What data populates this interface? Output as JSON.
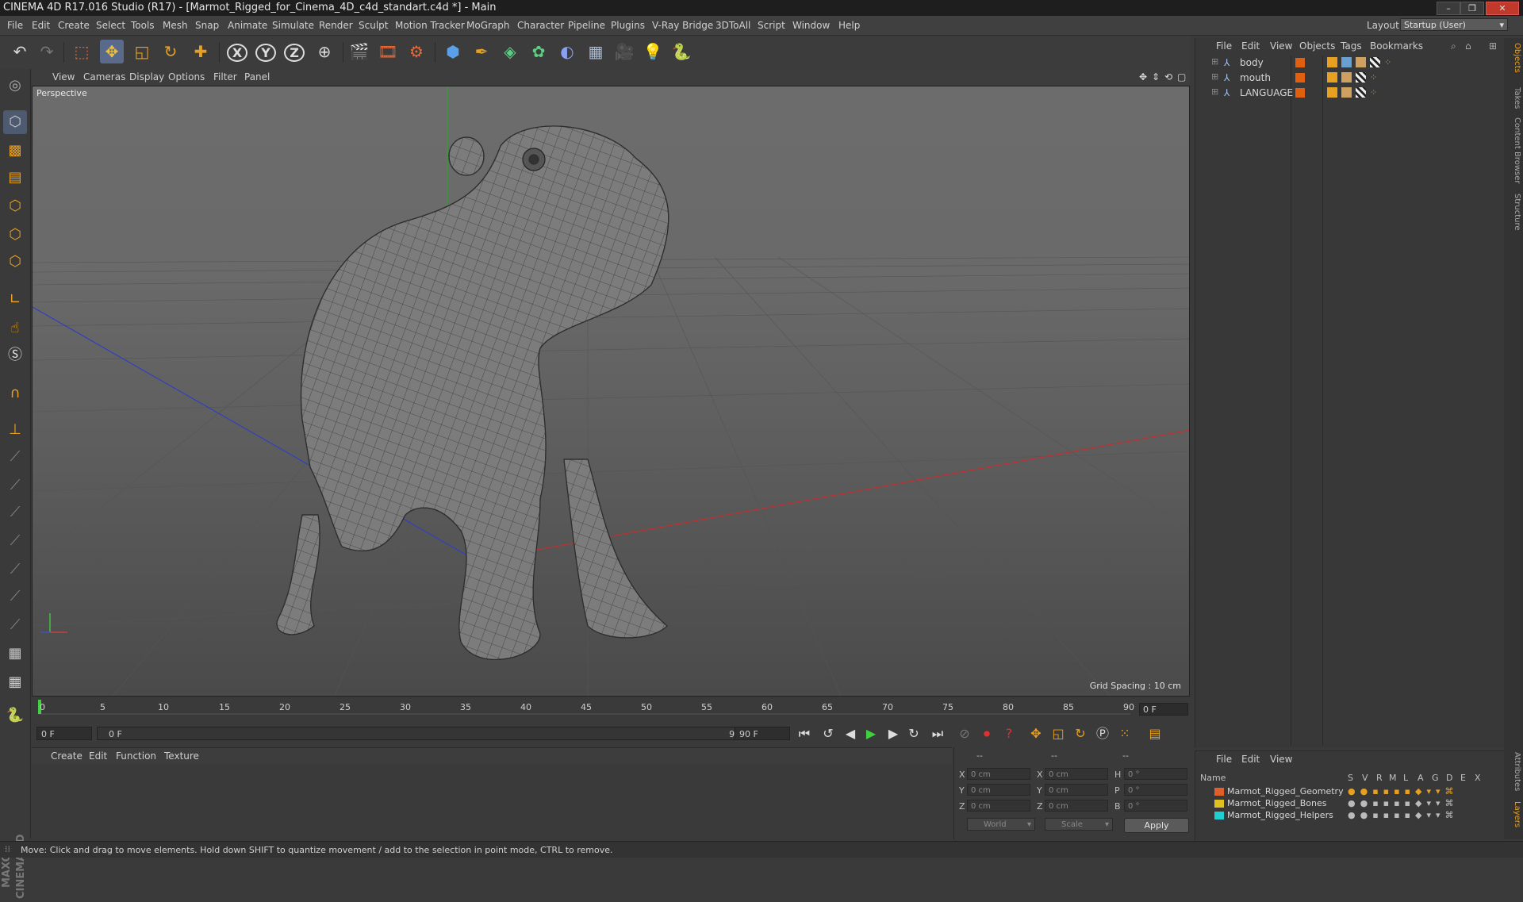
{
  "window": {
    "title": "CINEMA 4D R17.016 Studio (R17) - [Marmot_Rigged_for_Cinema_4D_c4d_standart.c4d *] - Main"
  },
  "menubar": {
    "items": [
      "File",
      "Edit",
      "Create",
      "Select",
      "Tools",
      "Mesh",
      "Snap",
      "Animate",
      "Simulate",
      "Render",
      "Sculpt",
      "Motion Tracker",
      "MoGraph",
      "Character",
      "Pipeline",
      "Plugins",
      "V-Ray Bridge",
      "3DToAll",
      "Script",
      "Window",
      "Help"
    ],
    "layout_label": "Layout:",
    "layout_value": "Startup (User)"
  },
  "toolbar": {
    "icons": [
      "undo-icon",
      "redo-icon",
      "select-icon",
      "move-icon",
      "scale-icon",
      "rotate-icon",
      "transform-icon",
      "x-axis-icon",
      "y-axis-icon",
      "z-axis-icon",
      "world-coord-icon",
      "render-view-icon",
      "render-picture-viewer-icon",
      "edit-render-settings-icon",
      "cube-icon",
      "pen-icon",
      "subdivision-icon",
      "cloner-icon",
      "deformer-icon",
      "floor-icon",
      "camera-icon",
      "light-icon",
      "python-icon"
    ],
    "axis_x": "X",
    "axis_y": "Y",
    "axis_z": "Z"
  },
  "viewport": {
    "menu": [
      "View",
      "Cameras",
      "Display",
      "Options",
      "Filter",
      "Panel"
    ],
    "label": "Perspective",
    "grid_spacing": "Grid Spacing : 10 cm"
  },
  "timeline": {
    "ticks": [
      "0",
      "5",
      "10",
      "15",
      "20",
      "25",
      "30",
      "35",
      "40",
      "45",
      "50",
      "55",
      "60",
      "65",
      "70",
      "75",
      "80",
      "85",
      "90"
    ],
    "current_frame": "0 F",
    "start_field": "0 F",
    "range_start": "0 F",
    "range_end": "90 F",
    "end_field": "90 F"
  },
  "material_manager": {
    "menu": [
      "Create",
      "Edit",
      "Function",
      "Texture"
    ]
  },
  "coordinates": {
    "headers": [
      "--",
      "--",
      "--"
    ],
    "rows": [
      {
        "label": "X",
        "pos": "0 cm",
        "size_label": "X",
        "size": "0 cm",
        "rot_label": "H",
        "rot": "0 °"
      },
      {
        "label": "Y",
        "pos": "0 cm",
        "size_label": "Y",
        "size": "0 cm",
        "rot_label": "P",
        "rot": "0 °"
      },
      {
        "label": "Z",
        "pos": "0 cm",
        "size_label": "Z",
        "size": "0 cm",
        "rot_label": "B",
        "rot": "0 °"
      }
    ],
    "space": "World",
    "mode": "Scale",
    "apply": "Apply"
  },
  "object_manager": {
    "menu": [
      "File",
      "Edit",
      "View",
      "Objects",
      "Tags",
      "Bookmarks"
    ],
    "objects": [
      {
        "name": "body"
      },
      {
        "name": "mouth"
      },
      {
        "name": "LANGUAGE"
      }
    ]
  },
  "layer_manager": {
    "menu": [
      "File",
      "Edit",
      "View"
    ],
    "header_name": "Name",
    "columns": [
      "S",
      "V",
      "R",
      "M",
      "L",
      "A",
      "G",
      "D",
      "E",
      "X"
    ],
    "layers": [
      {
        "name": "Marmot_Rigged_Geometry",
        "color": "#e0602a"
      },
      {
        "name": "Marmot_Rigged_Bones",
        "color": "#e0c020"
      },
      {
        "name": "Marmot_Rigged_Helpers",
        "color": "#20d0d0"
      }
    ]
  },
  "right_tabs": [
    "Objects",
    "Takes",
    "Content Browser",
    "Structure",
    "Attributes",
    "Layers"
  ],
  "branding": {
    "logo": "MAXON CINEMA 4D"
  },
  "status": {
    "text": "Move: Click and drag to move elements. Hold down SHIFT to quantize movement / add to the selection in point mode, CTRL to remove."
  }
}
